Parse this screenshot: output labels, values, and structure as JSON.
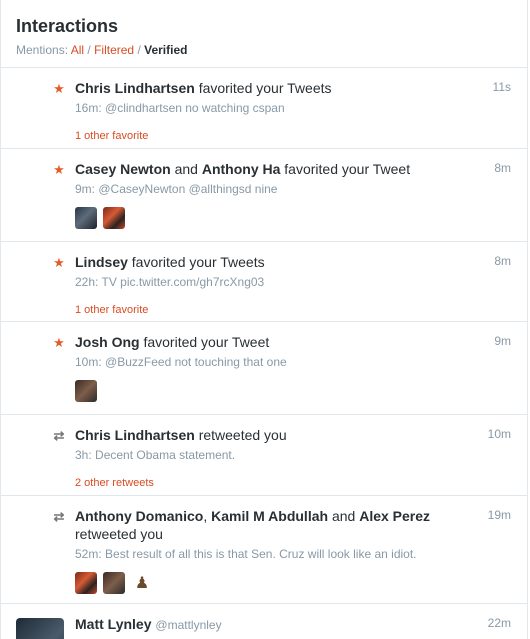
{
  "header": {
    "title": "Interactions",
    "mentions_label": "Mentions:",
    "filter_all": "All",
    "filter_filtered": "Filtered",
    "filter_verified": "Verified",
    "separator": "/"
  },
  "items": [
    {
      "type": "favorite",
      "icon": "star-icon",
      "names": [
        "Chris Lindhartsen"
      ],
      "action": "favorited your Tweets",
      "time": "11s",
      "tweet_time": "16m:",
      "tweet_text": "@clindhartsen no watching cspan",
      "other": "1 other favorite"
    },
    {
      "type": "favorite",
      "icon": "star-icon",
      "names": [
        "Casey Newton",
        "Anthony Ha"
      ],
      "joiner": "and",
      "action": "favorited your Tweet",
      "time": "8m",
      "tweet_time": "9m:",
      "tweet_text": "@CaseyNewton @allthingsd nine"
    },
    {
      "type": "favorite",
      "icon": "star-icon",
      "names": [
        "Lindsey"
      ],
      "action": "favorited your Tweets",
      "time": "8m",
      "tweet_time": "22h:",
      "tweet_text": "TV pic.twitter.com/gh7rcXng03",
      "other": "1 other favorite"
    },
    {
      "type": "favorite",
      "icon": "star-icon",
      "names": [
        "Josh Ong"
      ],
      "action": "favorited your Tweet",
      "time": "9m",
      "tweet_time": "10m:",
      "tweet_text": "@BuzzFeed not touching that one"
    },
    {
      "type": "retweet",
      "icon": "retweet-icon",
      "names": [
        "Chris Lindhartsen"
      ],
      "action": "retweeted you",
      "time": "10m",
      "tweet_time": "3h:",
      "tweet_text": "Decent Obama statement.",
      "other": "2 other retweets"
    },
    {
      "type": "retweet",
      "icon": "retweet-icon",
      "names": [
        "Anthony Domanico",
        "Kamil M Abdullah",
        "Alex Perez"
      ],
      "comma": ",",
      "joiner": "and",
      "action": "retweeted you",
      "time": "19m",
      "tweet_time": "52m:",
      "tweet_text": "Best result of all this is that Sen. Cruz will look like an idiot."
    },
    {
      "type": "tweet",
      "name": "Matt Lynley",
      "handle": "@mattlynley",
      "time": "22m"
    }
  ],
  "colors": {
    "accent": "#d84c22",
    "star": "#e55b2b",
    "muted": "#8899a6",
    "text": "#292f33"
  }
}
